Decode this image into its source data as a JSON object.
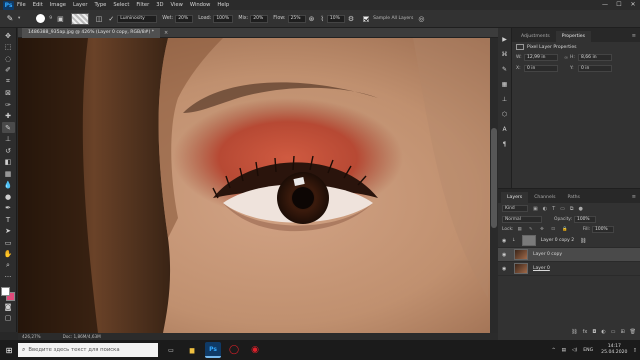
{
  "menubar": {
    "logo": "Ps",
    "items": [
      "File",
      "Edit",
      "Image",
      "Layer",
      "Type",
      "Select",
      "Filter",
      "3D",
      "View",
      "Window",
      "Help"
    ],
    "window_controls": [
      "—",
      "☐",
      "✕"
    ]
  },
  "options": {
    "brush_size": "9",
    "mode_label": "Mode:",
    "mode_value": "Luminosity",
    "opacity_label": "Load:",
    "opacity_value": "100%",
    "mix_label": "Mix:",
    "mix_value": "20%",
    "flow_label": "Flow:",
    "flow_value": "25%",
    "smoothing_value": "10%",
    "sample_label": "Sample All Layers"
  },
  "document": {
    "tab_title": "1486388_935ap.jpg @ 426% (Layer 0 copy, RGB/8#) *",
    "zoom": "426,27%",
    "doc_info": "Doc: 1,86M/4,63M"
  },
  "properties_panel": {
    "tabs": [
      "Adjustments",
      "Properties"
    ],
    "active_tab": "Properties",
    "title": "Pixel Layer Properties",
    "w_label": "W:",
    "w_value": "12,99 in",
    "h_label": "H:",
    "h_value": "8,66 in",
    "x_label": "X:",
    "x_value": "0 in",
    "y_label": "Y:",
    "y_value": "0 in"
  },
  "layers_panel": {
    "tabs": [
      "Layers",
      "Channels",
      "Paths"
    ],
    "active_tab": "Layers",
    "filter": "Kind",
    "blend_mode": "Normal",
    "opacity_label": "Opacity:",
    "opacity_value": "100%",
    "lock_label": "Lock:",
    "fill_label": "Fill:",
    "fill_value": "100%",
    "layers": [
      {
        "name": "Layer 0 copy 2"
      },
      {
        "name": "Layer 0 copy"
      },
      {
        "name": "Layer 0"
      }
    ]
  },
  "taskbar": {
    "search_placeholder": "Введите здесь текст для поиска",
    "language": "ENG",
    "time": "14:17",
    "date": "25.04.2020"
  }
}
